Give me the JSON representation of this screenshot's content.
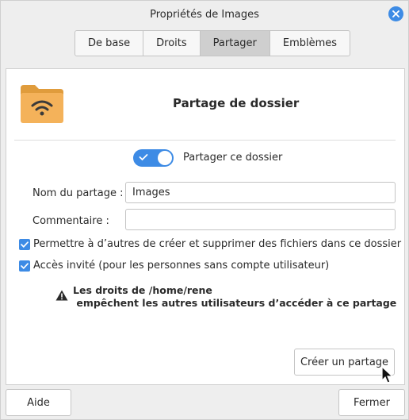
{
  "window": {
    "title": "Propriétés de Images"
  },
  "tabs": [
    {
      "label": "De base",
      "active": false
    },
    {
      "label": "Droits",
      "active": false
    },
    {
      "label": "Partager",
      "active": true
    },
    {
      "label": "Emblèmes",
      "active": false
    }
  ],
  "share": {
    "heading": "Partage de dossier",
    "toggle_label": "Partager ce dossier",
    "toggle_on": true,
    "name_label": "Nom du partage :",
    "name_value": "Images",
    "comment_label": "Commentaire :",
    "comment_value": "",
    "checkbox_allow_label": "Permettre à d’autres de créer et supprimer des fichiers dans ce dossier",
    "checkbox_allow_checked": true,
    "checkbox_guest_label": "Accès invité (pour les personnes sans compte utilisateur)",
    "checkbox_guest_checked": true,
    "warning_line1": "Les droits de /home/rene",
    "warning_line2": " empêchent les autres utilisateurs d’accéder à ce partage",
    "create_share_label": "Créer un partage"
  },
  "footer": {
    "help_label": "Aide",
    "close_label": "Fermer"
  },
  "icons": {
    "folder": "folder-wireless-icon",
    "close": "close-icon",
    "warning": "warning-icon",
    "check": "check-icon",
    "cursor": "mouse-cursor-icon"
  },
  "colors": {
    "accent": "#3d8be5",
    "folder": "#f4b25a",
    "folder_dark": "#e09c3c"
  }
}
